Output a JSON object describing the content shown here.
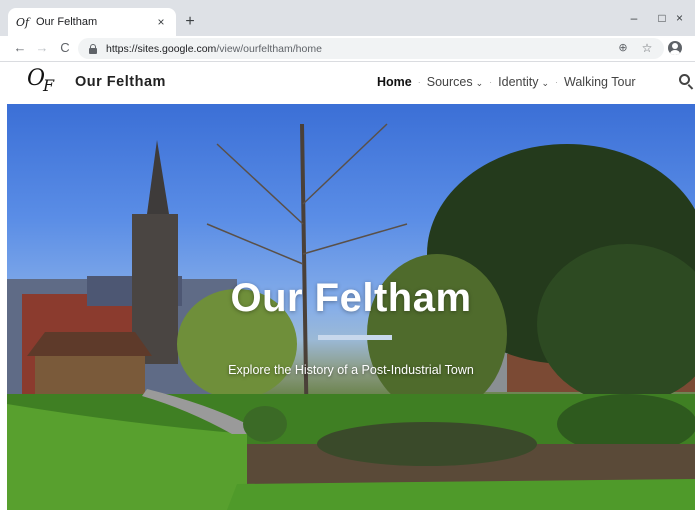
{
  "browser": {
    "tab": {
      "favicon_text": "Of",
      "title": "Our Feltham",
      "close_glyph": "×"
    },
    "new_tab_glyph": "+",
    "window_controls": {
      "minimize": "–",
      "maximize": "□",
      "close": "×"
    },
    "nav": {
      "back": "←",
      "forward": "→",
      "reload": "C"
    },
    "url": {
      "host": "https://sites.google.com",
      "path": "/view/ourfeltham/home"
    },
    "icons": {
      "zoom": "zoom-icon",
      "bookmark": "star-icon",
      "profile": "account-icon",
      "menu": "kebab-menu-icon"
    },
    "zoom_glyph": "⊕",
    "star_glyph": "☆",
    "menu_glyph": "⋮"
  },
  "site": {
    "logo": {
      "main": "O",
      "sub": "F"
    },
    "name": "Our Feltham",
    "nav": [
      {
        "label": "Home",
        "active": true,
        "dropdown": false
      },
      {
        "label": "Sources",
        "active": false,
        "dropdown": true
      },
      {
        "label": "Identity",
        "active": false,
        "dropdown": true
      },
      {
        "label": "Walking Tour",
        "active": false,
        "dropdown": false
      }
    ],
    "separator": "·",
    "caret": "⌄"
  },
  "hero": {
    "title": "Our Feltham",
    "tagline": "Explore the History of a Post-Industrial Town"
  }
}
